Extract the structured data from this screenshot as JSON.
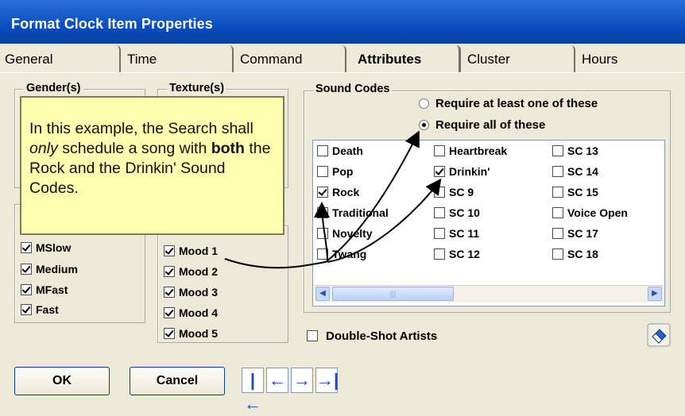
{
  "window": {
    "title": "Format Clock Item Properties"
  },
  "tabs": [
    {
      "label": "General"
    },
    {
      "label": "Time"
    },
    {
      "label": "Command"
    },
    {
      "label": "Attributes",
      "active": true
    },
    {
      "label": "Cluster"
    },
    {
      "label": "Hours"
    }
  ],
  "gender_group": {
    "label": "Gender(s)"
  },
  "texture_group": {
    "label": "Texture(s)"
  },
  "tempo_group": {
    "items": [
      {
        "label": "MSlow",
        "checked": true
      },
      {
        "label": "Medium",
        "checked": true
      },
      {
        "label": "MFast",
        "checked": true
      },
      {
        "label": "Fast",
        "checked": true
      }
    ]
  },
  "mood_group": {
    "items": [
      {
        "label": "Mood 1",
        "checked": true
      },
      {
        "label": "Mood 2",
        "checked": true
      },
      {
        "label": "Mood 3",
        "checked": true
      },
      {
        "label": "Mood 4",
        "checked": true
      },
      {
        "label": "Mood 5",
        "checked": true
      }
    ]
  },
  "sound_codes": {
    "label": "Sound Codes",
    "radio_any": "Require at least one of these",
    "radio_all": "Require all of these",
    "selected": "all",
    "columns": [
      [
        {
          "label": "Death",
          "checked": false
        },
        {
          "label": "Pop",
          "checked": false
        },
        {
          "label": "Rock",
          "checked": true
        },
        {
          "label": "Traditional",
          "checked": false
        },
        {
          "label": "Novelty",
          "checked": false
        },
        {
          "label": "Twang",
          "checked": false
        }
      ],
      [
        {
          "label": "Heartbreak",
          "checked": false
        },
        {
          "label": "Drinkin'",
          "checked": true
        },
        {
          "label": "SC 9",
          "checked": false
        },
        {
          "label": "SC 10",
          "checked": false
        },
        {
          "label": "SC 11",
          "checked": false
        },
        {
          "label": "SC 12",
          "checked": false
        }
      ],
      [
        {
          "label": "SC 13",
          "checked": false
        },
        {
          "label": "SC 14",
          "checked": false
        },
        {
          "label": "SC 15",
          "checked": false
        },
        {
          "label": "Voice Open",
          "checked": false
        },
        {
          "label": "SC 17",
          "checked": false
        },
        {
          "label": "SC 18",
          "checked": false
        }
      ]
    ]
  },
  "double_shot": {
    "label": "Double-Shot Artists",
    "checked": false
  },
  "buttons": {
    "ok": "OK",
    "cancel": "Cancel"
  },
  "nav_buttons": [
    {
      "icon": "first-record-icon",
      "glyph": "|←"
    },
    {
      "icon": "prev-record-icon",
      "glyph": "←"
    },
    {
      "icon": "next-record-icon",
      "glyph": "→"
    },
    {
      "icon": "last-record-icon",
      "glyph": "→|"
    }
  ],
  "callout": {
    "pre": "In this example, the Search shall ",
    "italic": "only",
    "mid": " schedule a song with ",
    "bold": "both",
    "post": " the Rock and the Drinkin' Sound Codes."
  }
}
